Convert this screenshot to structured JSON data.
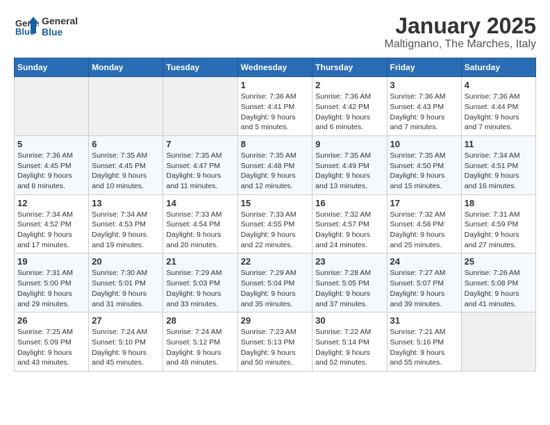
{
  "header": {
    "logo_line1": "General",
    "logo_line2": "Blue",
    "title": "January 2025",
    "subtitle": "Maltignano, The Marches, Italy"
  },
  "days_of_week": [
    "Sunday",
    "Monday",
    "Tuesday",
    "Wednesday",
    "Thursday",
    "Friday",
    "Saturday"
  ],
  "weeks": [
    [
      {
        "day": "",
        "info": ""
      },
      {
        "day": "",
        "info": ""
      },
      {
        "day": "",
        "info": ""
      },
      {
        "day": "1",
        "info": "Sunrise: 7:36 AM\nSunset: 4:41 PM\nDaylight: 9 hours and 5 minutes."
      },
      {
        "day": "2",
        "info": "Sunrise: 7:36 AM\nSunset: 4:42 PM\nDaylight: 9 hours and 6 minutes."
      },
      {
        "day": "3",
        "info": "Sunrise: 7:36 AM\nSunset: 4:43 PM\nDaylight: 9 hours and 7 minutes."
      },
      {
        "day": "4",
        "info": "Sunrise: 7:36 AM\nSunset: 4:44 PM\nDaylight: 9 hours and 7 minutes."
      }
    ],
    [
      {
        "day": "5",
        "info": "Sunrise: 7:36 AM\nSunset: 4:45 PM\nDaylight: 9 hours and 8 minutes."
      },
      {
        "day": "6",
        "info": "Sunrise: 7:35 AM\nSunset: 4:45 PM\nDaylight: 9 hours and 10 minutes."
      },
      {
        "day": "7",
        "info": "Sunrise: 7:35 AM\nSunset: 4:47 PM\nDaylight: 9 hours and 11 minutes."
      },
      {
        "day": "8",
        "info": "Sunrise: 7:35 AM\nSunset: 4:48 PM\nDaylight: 9 hours and 12 minutes."
      },
      {
        "day": "9",
        "info": "Sunrise: 7:35 AM\nSunset: 4:49 PM\nDaylight: 9 hours and 13 minutes."
      },
      {
        "day": "10",
        "info": "Sunrise: 7:35 AM\nSunset: 4:50 PM\nDaylight: 9 hours and 15 minutes."
      },
      {
        "day": "11",
        "info": "Sunrise: 7:34 AM\nSunset: 4:51 PM\nDaylight: 9 hours and 16 minutes."
      }
    ],
    [
      {
        "day": "12",
        "info": "Sunrise: 7:34 AM\nSunset: 4:52 PM\nDaylight: 9 hours and 17 minutes."
      },
      {
        "day": "13",
        "info": "Sunrise: 7:34 AM\nSunset: 4:53 PM\nDaylight: 9 hours and 19 minutes."
      },
      {
        "day": "14",
        "info": "Sunrise: 7:33 AM\nSunset: 4:54 PM\nDaylight: 9 hours and 20 minutes."
      },
      {
        "day": "15",
        "info": "Sunrise: 7:33 AM\nSunset: 4:55 PM\nDaylight: 9 hours and 22 minutes."
      },
      {
        "day": "16",
        "info": "Sunrise: 7:32 AM\nSunset: 4:57 PM\nDaylight: 9 hours and 24 minutes."
      },
      {
        "day": "17",
        "info": "Sunrise: 7:32 AM\nSunset: 4:58 PM\nDaylight: 9 hours and 25 minutes."
      },
      {
        "day": "18",
        "info": "Sunrise: 7:31 AM\nSunset: 4:59 PM\nDaylight: 9 hours and 27 minutes."
      }
    ],
    [
      {
        "day": "19",
        "info": "Sunrise: 7:31 AM\nSunset: 5:00 PM\nDaylight: 9 hours and 29 minutes."
      },
      {
        "day": "20",
        "info": "Sunrise: 7:30 AM\nSunset: 5:01 PM\nDaylight: 9 hours and 31 minutes."
      },
      {
        "day": "21",
        "info": "Sunrise: 7:29 AM\nSunset: 5:03 PM\nDaylight: 9 hours and 33 minutes."
      },
      {
        "day": "22",
        "info": "Sunrise: 7:29 AM\nSunset: 5:04 PM\nDaylight: 9 hours and 35 minutes."
      },
      {
        "day": "23",
        "info": "Sunrise: 7:28 AM\nSunset: 5:05 PM\nDaylight: 9 hours and 37 minutes."
      },
      {
        "day": "24",
        "info": "Sunrise: 7:27 AM\nSunset: 5:07 PM\nDaylight: 9 hours and 39 minutes."
      },
      {
        "day": "25",
        "info": "Sunrise: 7:26 AM\nSunset: 5:08 PM\nDaylight: 9 hours and 41 minutes."
      }
    ],
    [
      {
        "day": "26",
        "info": "Sunrise: 7:25 AM\nSunset: 5:09 PM\nDaylight: 9 hours and 43 minutes."
      },
      {
        "day": "27",
        "info": "Sunrise: 7:24 AM\nSunset: 5:10 PM\nDaylight: 9 hours and 45 minutes."
      },
      {
        "day": "28",
        "info": "Sunrise: 7:24 AM\nSunset: 5:12 PM\nDaylight: 9 hours and 48 minutes."
      },
      {
        "day": "29",
        "info": "Sunrise: 7:23 AM\nSunset: 5:13 PM\nDaylight: 9 hours and 50 minutes."
      },
      {
        "day": "30",
        "info": "Sunrise: 7:22 AM\nSunset: 5:14 PM\nDaylight: 9 hours and 52 minutes."
      },
      {
        "day": "31",
        "info": "Sunrise: 7:21 AM\nSunset: 5:16 PM\nDaylight: 9 hours and 55 minutes."
      },
      {
        "day": "",
        "info": ""
      }
    ]
  ]
}
